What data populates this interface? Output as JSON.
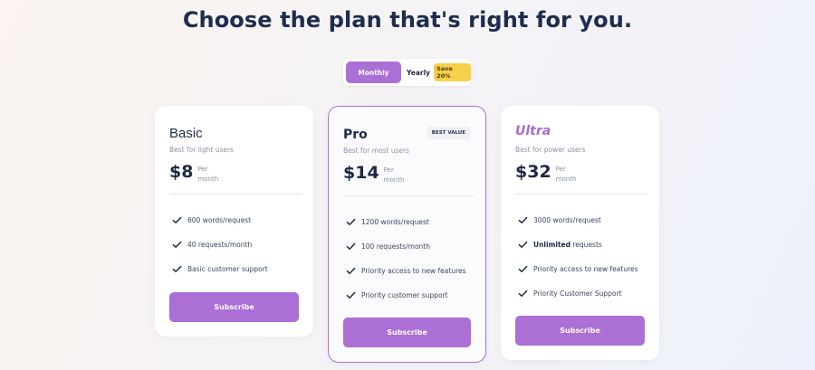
{
  "title": "Choose the plan that's right for you.",
  "billing_toggle": {
    "monthly_label": "Monthly",
    "yearly_label": "Yearly",
    "save_badge": "Save 20%",
    "selected": "Monthly"
  },
  "accent_color": "#ab6fd6",
  "plans": [
    {
      "name": "Basic",
      "tagline": "Best for light users",
      "price": "$8",
      "per_line1": "Per",
      "per_line2": "month",
      "features": [
        "600 words/request",
        "40 requests/month",
        "Basic customer support"
      ],
      "button_label": "Subscribe"
    },
    {
      "name": "Pro",
      "badge": "BEST VALUE",
      "tagline": "Best for most users",
      "price": "$14",
      "per_line1": "Per",
      "per_line2": "month",
      "features": [
        "1200 words/request",
        "100 requests/month",
        "Priority access to new features",
        "Priority customer support"
      ],
      "button_label": "Subscribe"
    },
    {
      "name": "Ultra",
      "tagline": "Best for power users",
      "price": "$32",
      "per_line1": "Per",
      "per_line2": "month",
      "features": [
        "3000 words/request",
        "requests",
        "Priority access to new features",
        "Priority Customer Support"
      ],
      "feature_bold_prefix": "Unlimited",
      "button_label": "Subscribe"
    }
  ],
  "icons": {
    "feature_check": "check-icon"
  }
}
